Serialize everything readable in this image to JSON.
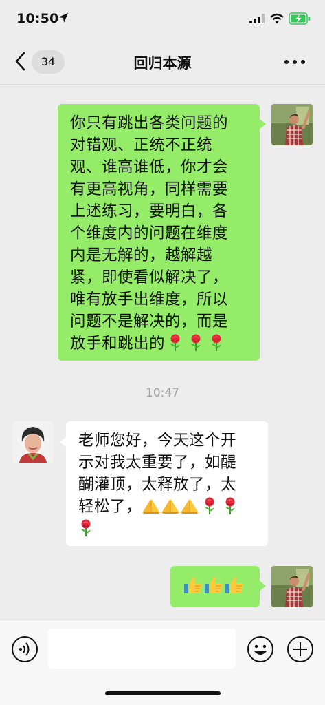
{
  "status_bar": {
    "time": "10:50",
    "icons": [
      "location-arrow-icon",
      "cellular-signal-icon",
      "wifi-icon",
      "battery-charging-icon"
    ],
    "battery_color": "#34c759"
  },
  "nav": {
    "back_icon": "chevron-left-icon",
    "unread_count": "34",
    "title": "回归本源",
    "more_icon": "more-dots-icon"
  },
  "messages": [
    {
      "side": "right",
      "bubble_color": "#95ec69",
      "lines": [
        "你只有跳出各类问题的",
        "对错观、正统不正统",
        "观、谁高谁低，你才会",
        "有更高视角，同样需要",
        "上述练习，要明白，各",
        "个维度内的问题在维度",
        "内是无解的，越解越",
        "紧，即使看似解决了，",
        "唯有放手出维度，所以",
        "问题不是解决的，而是",
        "放手和跳出的"
      ],
      "trailing_emoji": [
        "rose-icon",
        "rose-icon",
        "rose-icon"
      ]
    },
    {
      "timestamp": "10:47"
    },
    {
      "side": "left",
      "bubble_color": "#ffffff",
      "lines": [
        "老师您好，今天这个开",
        "示对我太重要了，如醍",
        "醐灌顶，太释放了，太",
        "轻松了，"
      ],
      "trailing_emoji": [
        "pray-icon",
        "pray-icon",
        "pray-icon",
        "rose-icon",
        "rose-icon",
        "rose-icon"
      ]
    },
    {
      "side": "right",
      "bubble_color": "#95ec69",
      "trailing_emoji": [
        "thumbs-up-icon",
        "thumbs-up-icon",
        "thumbs-up-icon"
      ]
    }
  ],
  "input_bar": {
    "voice_icon": "voice-input-icon",
    "input_value": "",
    "emoji_icon": "emoji-icon",
    "plus_icon": "plus-icon"
  }
}
